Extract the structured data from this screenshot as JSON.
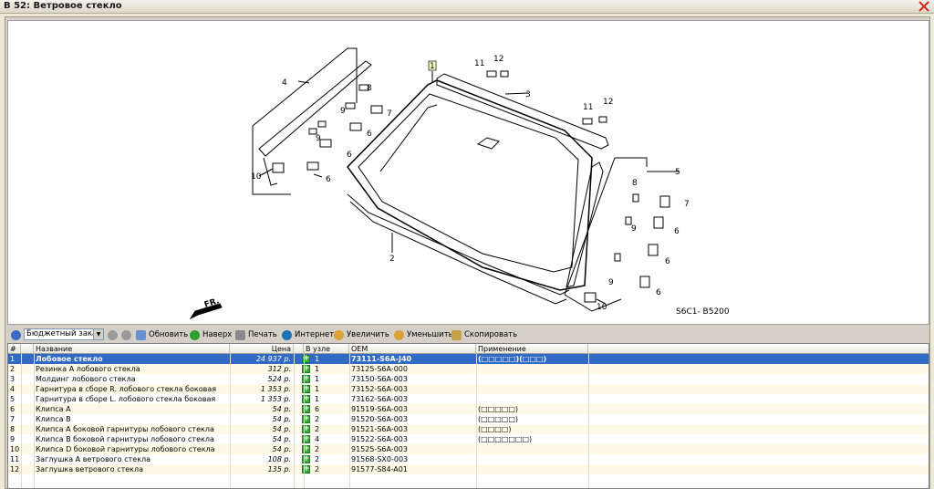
{
  "window": {
    "title": "B 52: Ветровое стекло"
  },
  "diagram": {
    "callouts": [
      "1",
      "2",
      "3",
      "4",
      "5",
      "6",
      "7",
      "8",
      "9",
      "10",
      "11",
      "12"
    ],
    "code": "S6C1- B5200",
    "front_label": "FR."
  },
  "toolbar": {
    "select_value": "Бюджетный зака",
    "refresh": "Обновить",
    "up": "Наверх",
    "print": "Печать",
    "internet": "Интернет",
    "zoom_in": "Увеличить",
    "zoom_out": "Уменьшить",
    "copy": "Скопировать"
  },
  "table": {
    "headers": {
      "num": "#",
      "name": "Название",
      "price": "Цена",
      "qty": "В узле",
      "oem": "OEM",
      "application": "Применение"
    },
    "rows": [
      {
        "num": "1",
        "name": "Лобовое стекло",
        "price": "24 937 р.",
        "qty": "1",
        "oem": "73111-S6A-J40",
        "application": "(□□□□□)(□□□)"
      },
      {
        "num": "2",
        "name": "Резинка А лобового стекла",
        "price": "312 р.",
        "qty": "1",
        "oem": "73125-S6A-000",
        "application": ""
      },
      {
        "num": "3",
        "name": "Молдинг лобового стекла",
        "price": "524 р.",
        "qty": "1",
        "oem": "73150-S6A-003",
        "application": ""
      },
      {
        "num": "4",
        "name": "Гарнитура в сборе R. лобового стекла боковая",
        "price": "1 353 р.",
        "qty": "1",
        "oem": "73152-S6A-003",
        "application": ""
      },
      {
        "num": "5",
        "name": "Гарнитура в сборе L. лобового стекла боковая",
        "price": "1 353 р.",
        "qty": "1",
        "oem": "73162-S6A-003",
        "application": ""
      },
      {
        "num": "6",
        "name": "Клипса А",
        "price": "54 р.",
        "qty": "6",
        "oem": "91519-S6A-003",
        "application": "(□□□□□)"
      },
      {
        "num": "7",
        "name": "Клипса В",
        "price": "54 р.",
        "qty": "2",
        "oem": "91520-S6A-003",
        "application": "(□□□□□)"
      },
      {
        "num": "8",
        "name": "Клипса А боковой гарнитуры лобового стекла",
        "price": "54 р.",
        "qty": "2",
        "oem": "91521-S6A-003",
        "application": "(□□□□)"
      },
      {
        "num": "9",
        "name": "Клипса В боковой гарнитуры лобового стекла",
        "price": "54 р.",
        "qty": "4",
        "oem": "91522-S6A-003",
        "application": "(□□□□□□□)"
      },
      {
        "num": "10",
        "name": "Клипса D боковой гарнитуры лобового стекла",
        "price": "54 р.",
        "qty": "2",
        "oem": "91525-S6A-003",
        "application": ""
      },
      {
        "num": "11",
        "name": "Заглушка А ветрового стекла",
        "price": "108 р.",
        "qty": "2",
        "oem": "91568-SX0-003",
        "application": ""
      },
      {
        "num": "12",
        "name": "Заглушка ветрового стекла",
        "price": "135 р.",
        "qty": "2",
        "oem": "91577-S84-A01",
        "application": ""
      }
    ]
  },
  "colors": {
    "selected_row": "#316ac5",
    "even_row": "#fdfbe7",
    "close_icon": "#d9261c",
    "add_button": "#3aa63a"
  }
}
